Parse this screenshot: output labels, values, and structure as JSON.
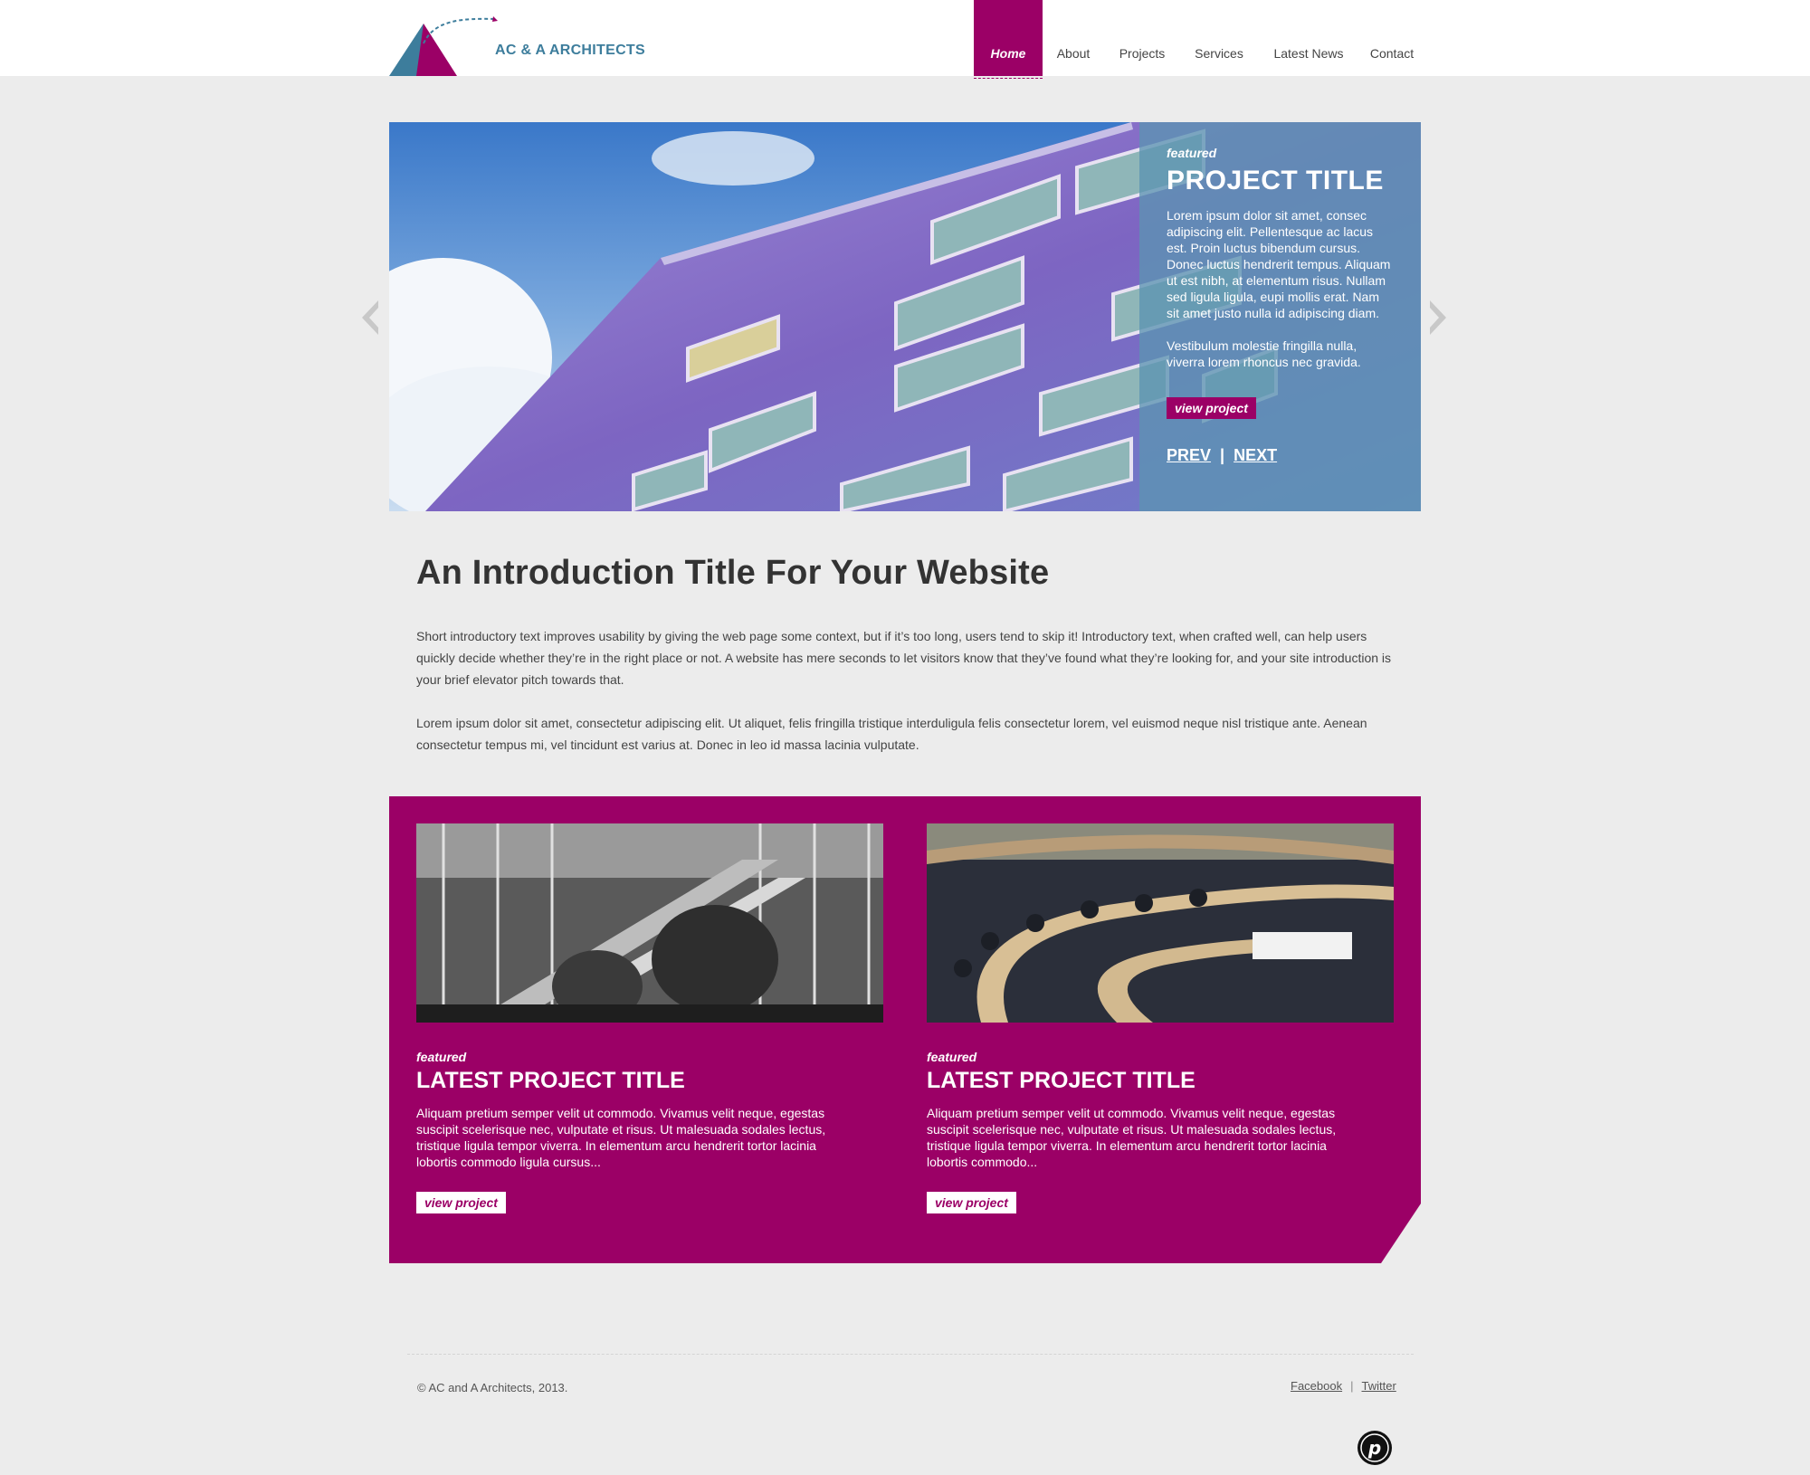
{
  "brand": {
    "name": "AC & A ARCHITECTS",
    "accent": "#9b0066",
    "logo_blue": "#3d7d9c"
  },
  "nav": {
    "items": [
      {
        "label": "Home",
        "active": true
      },
      {
        "label": "About"
      },
      {
        "label": "Projects"
      },
      {
        "label": "Services"
      },
      {
        "label": "Latest News"
      },
      {
        "label": "Contact"
      }
    ]
  },
  "slider": {
    "featured": "featured",
    "title": "PROJECT TITLE",
    "text1": "Lorem ipsum dolor sit amet, consec adipiscing elit. Pellentesque ac lacus est. Proin luctus bibendum cursus. Donec luctus hendrerit tempus. Aliquam ut est nibh, at elementum risus. Nullam sed ligula ligula, eupi mollis erat. Nam sit amet justo nulla id adipiscing diam.",
    "text2": "Vestibulum molestie fringilla nulla, viverra lorem rhoncus nec gravida.",
    "button": "view project",
    "prev": "PREV",
    "separator": "|",
    "next": "NEXT",
    "arrow_left_icon": "chevron-left-icon",
    "arrow_right_icon": "chevron-right-icon"
  },
  "intro": {
    "title": "An Introduction Title For Your Website",
    "paragraph1": "Short introductory text improves usability by giving the web page some context, but if it’s too long, users tend to skip it! Introductory text, when crafted well, can help users quickly decide whether they’re in the right place or not. A website has mere seconds to let visitors know that they’ve found what they’re looking for, and your site introduction is your brief elevator pitch towards that.",
    "paragraph2": "Lorem ipsum dolor sit amet, consectetur adipiscing elit. Ut aliquet, felis fringilla tristique interduligula felis consectetur lorem, vel euismod neque nisl tristique ante. Aenean consectetur tempus mi, vel tincidunt est varius at. Donec in leo id massa lacinia vulputate."
  },
  "latest": {
    "cards": [
      {
        "featured": "featured",
        "title": "LATEST PROJECT TITLE",
        "text": "Aliquam pretium semper velit ut commodo. Vivamus velit neque, egestas suscipit scelerisque nec, vulputate et risus. Ut malesuada sodales lectus, tristique ligula tempor viverra. In elementum arcu hendrerit tortor lacinia lobortis commodo ligula cursus...",
        "button": "view project"
      },
      {
        "featured": "featured",
        "title": "LATEST PROJECT TITLE",
        "text": "Aliquam pretium semper velit ut commodo. Vivamus velit neque, egestas suscipit scelerisque nec, vulputate et risus. Ut malesuada sodales lectus, tristique ligula tempor viverra. In elementum arcu hendrerit tortor lacinia lobortis commodo...",
        "button": "view project"
      }
    ]
  },
  "footer": {
    "copyright": "© AC and A Architects, 2013.",
    "facebook": "Facebook",
    "separator": "|",
    "twitter": "Twitter",
    "badge_letter": "p"
  }
}
